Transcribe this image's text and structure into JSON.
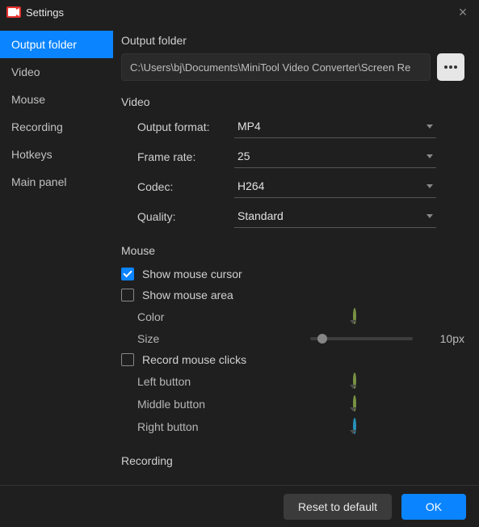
{
  "window": {
    "title": "Settings"
  },
  "sidebar": {
    "items": [
      {
        "label": "Output folder",
        "active": true
      },
      {
        "label": "Video"
      },
      {
        "label": "Mouse"
      },
      {
        "label": "Recording"
      },
      {
        "label": "Hotkeys"
      },
      {
        "label": "Main panel"
      }
    ]
  },
  "sections": {
    "output_folder": {
      "title": "Output folder",
      "path": "C:\\Users\\bj\\Documents\\MiniTool Video Converter\\Screen Re"
    },
    "video": {
      "title": "Video",
      "output_format_label": "Output format:",
      "output_format_value": "MP4",
      "frame_rate_label": "Frame rate:",
      "frame_rate_value": "25",
      "codec_label": "Codec:",
      "codec_value": "H264",
      "quality_label": "Quality:",
      "quality_value": "Standard"
    },
    "mouse": {
      "title": "Mouse",
      "show_cursor_label": "Show mouse cursor",
      "show_cursor_checked": true,
      "show_area_label": "Show mouse area",
      "show_area_checked": false,
      "color_label": "Color",
      "size_label": "Size",
      "size_value": "10px",
      "record_clicks_label": "Record mouse clicks",
      "record_clicks_checked": false,
      "left_button_label": "Left button",
      "middle_button_label": "Middle button",
      "right_button_label": "Right button"
    },
    "recording": {
      "title": "Recording"
    }
  },
  "footer": {
    "reset_label": "Reset to default",
    "ok_label": "OK"
  }
}
